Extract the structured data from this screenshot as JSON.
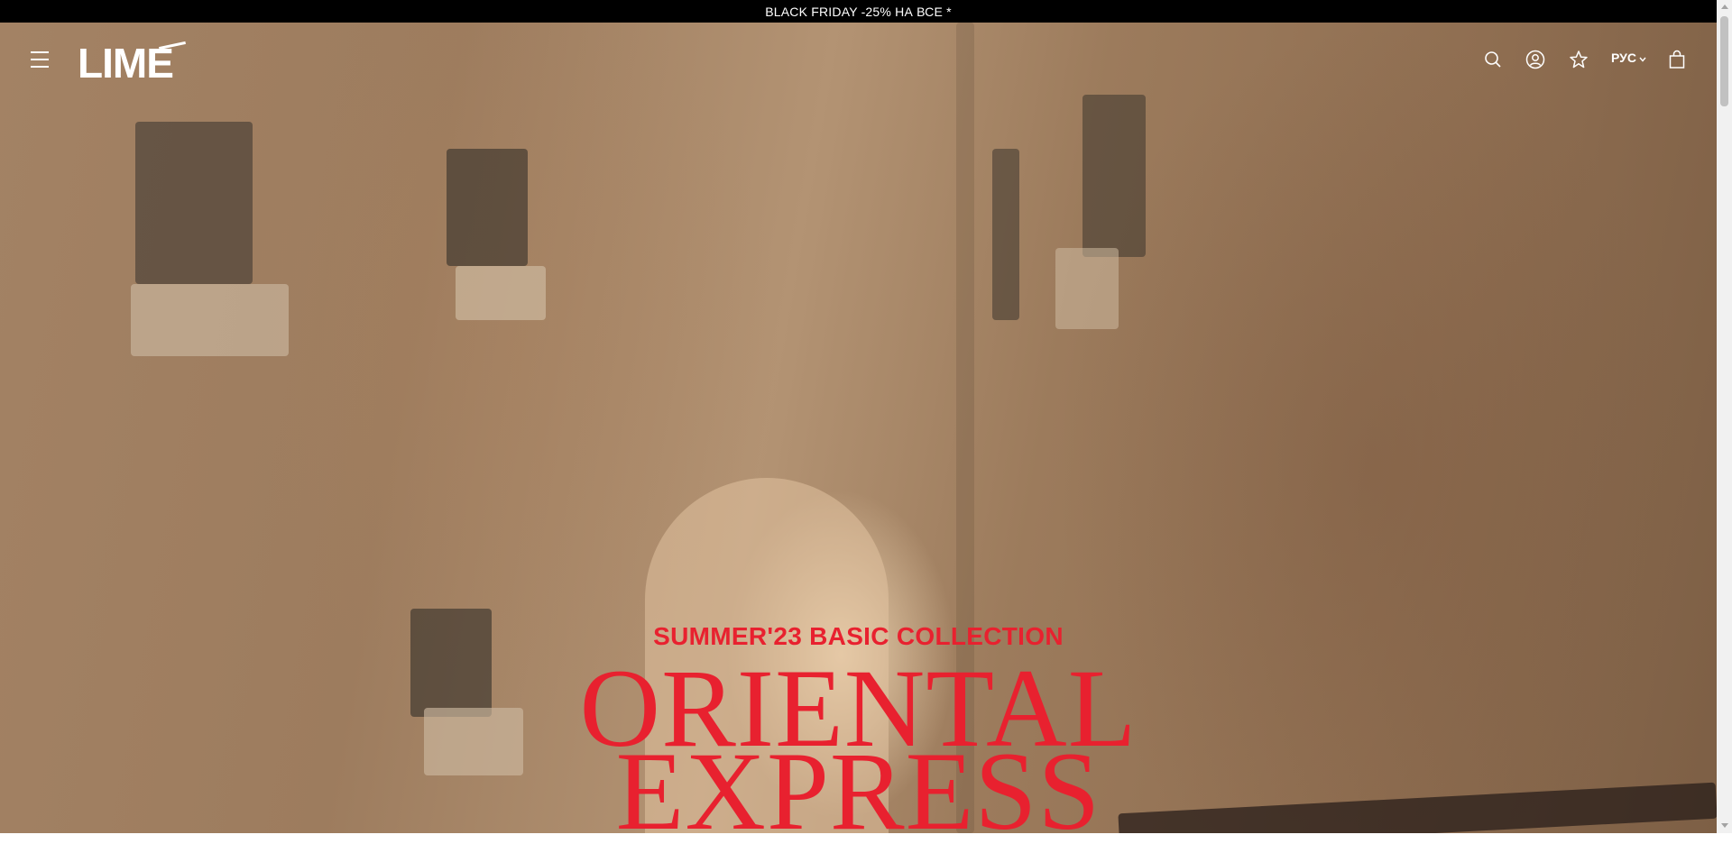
{
  "promo": {
    "text": "BLACK FRIDAY -25% НА ВСЕ *"
  },
  "header": {
    "logo_text": "LIME",
    "language": "РУС"
  },
  "hero": {
    "subtitle": "SUMMER'23 BASIC COLLECTION",
    "title_line1": "ORIENTAL",
    "title_line2": "EXPRESS"
  },
  "colors": {
    "accent": "#e8212f",
    "promo_bg": "#000000"
  },
  "icons": [
    "menu-icon",
    "search-icon",
    "account-icon",
    "favorites-star-icon",
    "chevron-down-icon",
    "shopping-bag-icon"
  ]
}
